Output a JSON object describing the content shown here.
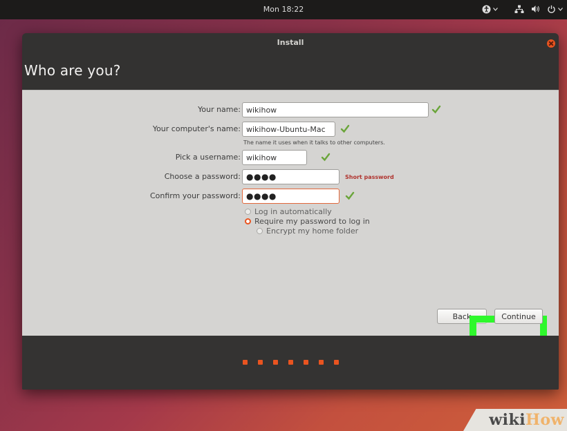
{
  "topbar": {
    "clock": "Mon 18:22",
    "tray_icons": [
      "accessibility-icon",
      "network-icon",
      "volume-icon",
      "power-icon"
    ]
  },
  "window": {
    "title": "Install",
    "heading": "Who are you?"
  },
  "form": {
    "name_label": "Your name:",
    "name_value": "wikihow",
    "computer_label": "Your computer's name:",
    "computer_value": "wikihow-Ubuntu-Mac",
    "computer_hint": "The name it uses when it talks to other computers.",
    "username_label": "Pick a username:",
    "username_value": "wikihow",
    "password_label": "Choose a password:",
    "password_value": "●●●●",
    "password_warning": "Short password",
    "confirm_label": "Confirm your password:",
    "confirm_value": "●●●●",
    "options": [
      {
        "label": "Log in automatically",
        "selected": false
      },
      {
        "label": "Require my password to log in",
        "selected": true
      },
      {
        "label": "Encrypt my home folder",
        "selected": false
      }
    ]
  },
  "buttons": {
    "back": "Back",
    "continue": "Continue"
  },
  "progress": {
    "step_count": 7
  },
  "watermark": {
    "part1": "wiki",
    "part2": "How"
  },
  "colors": {
    "accent": "#e95420",
    "highlight": "#2ef82c",
    "window_bg": "#333231",
    "panel_bg": "#d5d4d2"
  }
}
